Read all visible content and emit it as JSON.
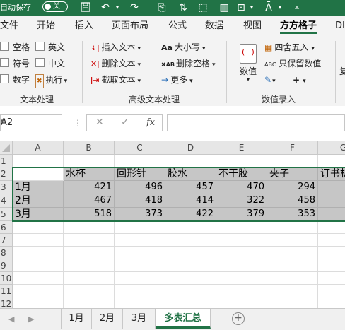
{
  "titlebar": {
    "autosave_label": "自动保存",
    "toggle_state": "关"
  },
  "ribbon_tabs": [
    "文件",
    "开始",
    "插入",
    "页面布局",
    "公式",
    "数据",
    "视图",
    "方方格子",
    "DI"
  ],
  "active_tab": "方方格子",
  "ribbon": {
    "text_group": {
      "checkboxes": [
        "空格",
        "英文",
        "符号",
        "中文",
        "数字"
      ],
      "execute": "执行",
      "group_label": "文本处理"
    },
    "advanced_group": {
      "insert_text": "插入文本",
      "delete_text": "删除文本",
      "extract_text": "截取文本",
      "case": "大小写",
      "delete_space": "删除空格",
      "more": "更多",
      "group_label": "高级文本处理"
    },
    "number_group": {
      "value": "数值",
      "round": "四舍五入",
      "keep_number": "只保留数值",
      "group_label": "数值录入",
      "aa_icon": "Aa",
      "abc_icon": "ABC"
    },
    "cutoff_label": "复"
  },
  "formula_bar": {
    "name_box": "A2",
    "cancel": "✕",
    "confirm": "✓",
    "fx": "fx",
    "value": ""
  },
  "grid": {
    "columns": [
      "A",
      "B",
      "C",
      "D",
      "E",
      "F",
      "G"
    ],
    "rows": [
      "1",
      "2",
      "3",
      "4",
      "5",
      "6",
      "7",
      "8",
      "9",
      "10",
      "11",
      "12"
    ],
    "header_row": [
      "",
      "水杯",
      "回形针",
      "胶水",
      "不干胶",
      "夹子",
      "订书机"
    ],
    "data_rows": [
      {
        "label": "1月",
        "values": [
          421,
          496,
          457,
          470,
          294
        ]
      },
      {
        "label": "2月",
        "values": [
          467,
          418,
          414,
          322,
          458
        ]
      },
      {
        "label": "3月",
        "values": [
          518,
          373,
          422,
          379,
          353
        ]
      }
    ]
  },
  "sheet_tabs": [
    "1月",
    "2月",
    "3月",
    "多表汇总"
  ],
  "active_sheet": "多表汇总",
  "accent_color": "#217346"
}
